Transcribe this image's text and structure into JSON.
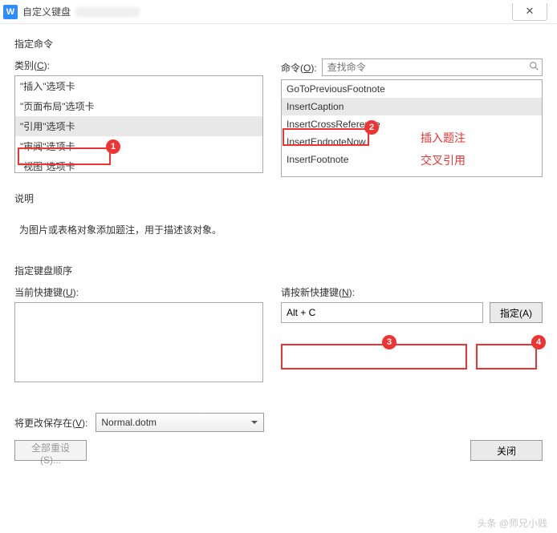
{
  "window": {
    "title": "自定义键盘",
    "close_glyph": "✕"
  },
  "sections": {
    "assign_cmd": "指定命令",
    "description": "说明",
    "kb_sequence": "指定键盘顺序"
  },
  "labels": {
    "category": "类别(",
    "category_u": "C",
    "category_end": "):",
    "command": "命令(",
    "command_u": "O",
    "command_end": "):",
    "current_keys": "当前快捷键(",
    "current_keys_u": "U",
    "current_keys_end": "):",
    "press_new": "请按新快捷键(",
    "press_new_u": "N",
    "press_new_end": "):",
    "save_in": "将更改保存在(",
    "save_in_u": "V",
    "save_in_end": "):"
  },
  "search": {
    "placeholder": "查找命令"
  },
  "categories": {
    "items": [
      {
        "label": "\"插入\"选项卡"
      },
      {
        "label": "\"页面布局\"选项卡"
      },
      {
        "label": "\"引用\"选项卡",
        "selected": true
      },
      {
        "label": "\"审阅\"选项卡"
      },
      {
        "label": "\"视图\"选项卡"
      }
    ]
  },
  "commands": {
    "items": [
      {
        "label": "GoToPreviousFootnote"
      },
      {
        "label": "InsertCaption",
        "selected": true
      },
      {
        "label": "InsertCrossReference"
      },
      {
        "label": "InsertEndnoteNow"
      },
      {
        "label": "InsertFootnote"
      }
    ]
  },
  "description_text": "为图片或表格对象添加题注，用于描述该对象。",
  "shortcut": {
    "current": "",
    "new": "Alt + C"
  },
  "buttons": {
    "assign": "指定(A)",
    "reset_all": "全部重设(S)...",
    "close": "关闭"
  },
  "select": {
    "value": "Normal.dotm"
  },
  "annotations": {
    "a1": "插入题注",
    "a2": "交叉引用"
  },
  "watermark": "头条 @师兄小贱"
}
